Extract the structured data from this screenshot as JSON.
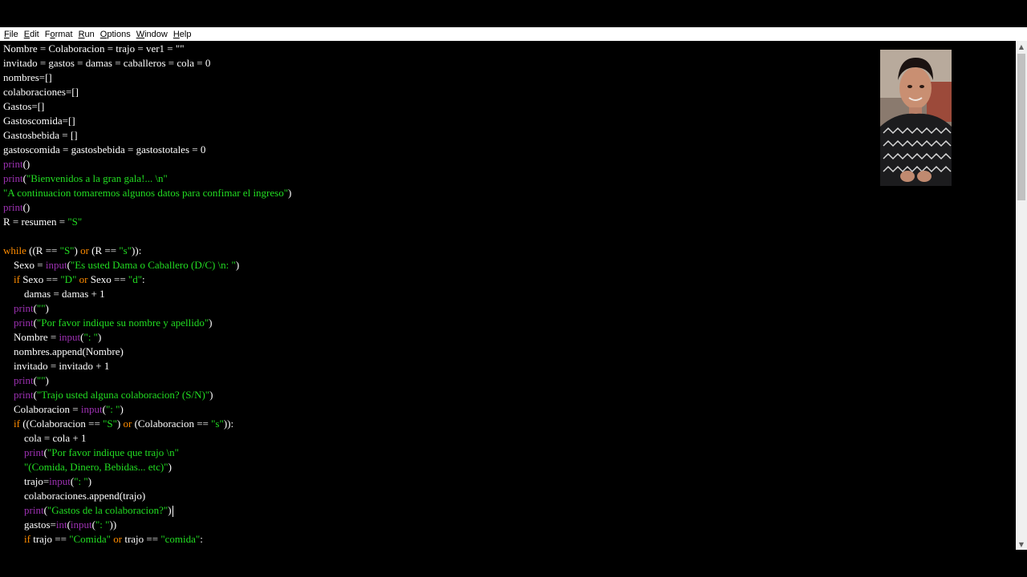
{
  "menubar": {
    "items": [
      {
        "key": "F",
        "rest": "ile"
      },
      {
        "key": "E",
        "rest": "dit"
      },
      {
        "key": "",
        "pre": "F",
        "keyMid": "o",
        "rest": "rmat"
      },
      {
        "key": "R",
        "rest": "un"
      },
      {
        "key": "O",
        "rest": "ptions"
      },
      {
        "key": "W",
        "rest": "indow"
      },
      {
        "key": "H",
        "rest": "elp"
      }
    ]
  },
  "editor": {
    "lines": [
      [
        [
          "pl",
          "Nombre = Colaboracion = trajo = ver1 = \"\""
        ]
      ],
      [
        [
          "pl",
          "invitado = gastos = damas = caballeros = cola = 0"
        ]
      ],
      [
        [
          "pl",
          "nombres=[]"
        ]
      ],
      [
        [
          "pl",
          "colaboraciones=[]"
        ]
      ],
      [
        [
          "pl",
          "Gastos=[]"
        ]
      ],
      [
        [
          "pl",
          "Gastoscomida=[]"
        ]
      ],
      [
        [
          "pl",
          "Gastosbebida = []"
        ]
      ],
      [
        [
          "pl",
          "gastoscomida = gastosbebida = gastostotales = 0"
        ]
      ],
      [
        [
          "bi",
          "print"
        ],
        [
          "pl",
          "()"
        ]
      ],
      [
        [
          "bi",
          "print"
        ],
        [
          "pl",
          "("
        ],
        [
          "str",
          "\"Bienvenidos a la gran gala!... \\n\""
        ]
      ],
      [
        [
          "str",
          "\"A continuacion tomaremos algunos datos para confimar el ingreso\""
        ],
        [
          "pl",
          ")"
        ]
      ],
      [
        [
          "bi",
          "print"
        ],
        [
          "pl",
          "()"
        ]
      ],
      [
        [
          "pl",
          "R = resumen = "
        ],
        [
          "str",
          "\"S\""
        ]
      ],
      [],
      [
        [
          "kw",
          "while"
        ],
        [
          "pl",
          " ((R == "
        ],
        [
          "str",
          "\"S\""
        ],
        [
          "pl",
          ") "
        ],
        [
          "kw",
          "or"
        ],
        [
          "pl",
          " (R == "
        ],
        [
          "str",
          "\"s\""
        ],
        [
          "pl",
          ")):"
        ]
      ],
      [
        [
          "pl",
          "    Sexo = "
        ],
        [
          "bi",
          "input"
        ],
        [
          "pl",
          "("
        ],
        [
          "str",
          "\"Es usted Dama o Caballero (D/C) \\n: \""
        ],
        [
          "pl",
          ")"
        ]
      ],
      [
        [
          "pl",
          "    "
        ],
        [
          "kw",
          "if"
        ],
        [
          "pl",
          " Sexo == "
        ],
        [
          "str",
          "\"D\""
        ],
        [
          "pl",
          " "
        ],
        [
          "kw",
          "or"
        ],
        [
          "pl",
          " Sexo == "
        ],
        [
          "str",
          "\"d\""
        ],
        [
          "pl",
          ":"
        ]
      ],
      [
        [
          "pl",
          "        damas = damas + 1"
        ]
      ],
      [
        [
          "pl",
          "    "
        ],
        [
          "bi",
          "print"
        ],
        [
          "pl",
          "("
        ],
        [
          "str",
          "\"\""
        ],
        [
          "pl",
          ")"
        ]
      ],
      [
        [
          "pl",
          "    "
        ],
        [
          "bi",
          "print"
        ],
        [
          "pl",
          "("
        ],
        [
          "str",
          "\"Por favor indique su nombre y apellido\""
        ],
        [
          "pl",
          ")"
        ]
      ],
      [
        [
          "pl",
          "    Nombre = "
        ],
        [
          "bi",
          "input"
        ],
        [
          "pl",
          "("
        ],
        [
          "str",
          "\": \""
        ],
        [
          "pl",
          ")"
        ]
      ],
      [
        [
          "pl",
          "    nombres.append(Nombre)"
        ]
      ],
      [
        [
          "pl",
          "    invitado = invitado + 1"
        ]
      ],
      [
        [
          "pl",
          "    "
        ],
        [
          "bi",
          "print"
        ],
        [
          "pl",
          "("
        ],
        [
          "str",
          "\"\""
        ],
        [
          "pl",
          ")"
        ]
      ],
      [
        [
          "pl",
          "    "
        ],
        [
          "bi",
          "print"
        ],
        [
          "pl",
          "("
        ],
        [
          "str",
          "\"Trajo usted alguna colaboracion? (S/N)\""
        ],
        [
          "pl",
          ")"
        ]
      ],
      [
        [
          "pl",
          "    Colaboracion = "
        ],
        [
          "bi",
          "input"
        ],
        [
          "pl",
          "("
        ],
        [
          "str",
          "\": \""
        ],
        [
          "pl",
          ")"
        ]
      ],
      [
        [
          "pl",
          "    "
        ],
        [
          "kw",
          "if"
        ],
        [
          "pl",
          " ((Colaboracion == "
        ],
        [
          "str",
          "\"S\""
        ],
        [
          "pl",
          ") "
        ],
        [
          "kw",
          "or"
        ],
        [
          "pl",
          " (Colaboracion == "
        ],
        [
          "str",
          "\"s\""
        ],
        [
          "pl",
          ")):"
        ]
      ],
      [
        [
          "pl",
          "        cola = cola + 1"
        ]
      ],
      [
        [
          "pl",
          "        "
        ],
        [
          "bi",
          "print"
        ],
        [
          "pl",
          "("
        ],
        [
          "str",
          "\"Por favor indique que trajo \\n\""
        ]
      ],
      [
        [
          "pl",
          "        "
        ],
        [
          "str",
          "\"(Comida, Dinero, Bebidas... etc)\""
        ],
        [
          "pl",
          ")"
        ]
      ],
      [
        [
          "pl",
          "        trajo="
        ],
        [
          "bi",
          "input"
        ],
        [
          "pl",
          "("
        ],
        [
          "str",
          "\": \""
        ],
        [
          "pl",
          ")"
        ]
      ],
      [
        [
          "pl",
          "        colaboraciones.append(trajo)"
        ]
      ],
      [
        [
          "pl",
          "        "
        ],
        [
          "bi",
          "print"
        ],
        [
          "pl",
          "("
        ],
        [
          "str",
          "\"Gastos de la colaboracion?\""
        ],
        [
          "pl",
          ")"
        ]
      ],
      [
        [
          "pl",
          "        gastos="
        ],
        [
          "bi",
          "int"
        ],
        [
          "pl",
          "("
        ],
        [
          "bi",
          "input"
        ],
        [
          "pl",
          "("
        ],
        [
          "str",
          "\": \""
        ],
        [
          "pl",
          "))"
        ]
      ],
      [
        [
          "pl",
          "        "
        ],
        [
          "kw",
          "if"
        ],
        [
          "pl",
          " trajo == "
        ],
        [
          "str",
          "\"Comida\""
        ],
        [
          "pl",
          " "
        ],
        [
          "kw",
          "or"
        ],
        [
          "pl",
          " trajo == "
        ],
        [
          "str",
          "\"comida\""
        ],
        [
          "pl",
          ":"
        ]
      ]
    ],
    "cursor_line": 32
  },
  "colors": {
    "keyword": "#ff8c00",
    "builtin": "#9b30b0",
    "string": "#22dd22",
    "text": "#ffffff",
    "background": "#000000"
  },
  "icons": {
    "scroll_up": "scroll-up-arrow-icon",
    "scroll_down": "scroll-down-arrow-icon"
  }
}
